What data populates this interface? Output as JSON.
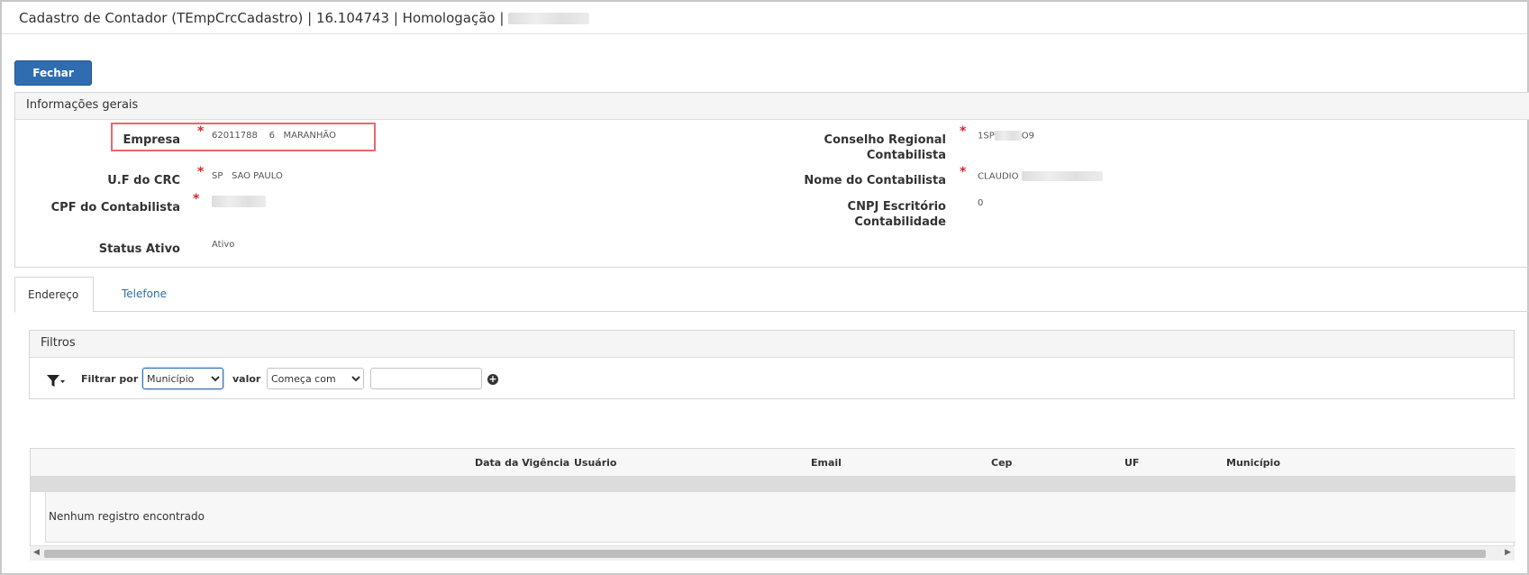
{
  "window": {
    "title": "Cadastro de Contador (TEmpCrcCadastro) | 16.104743 | Homologação |"
  },
  "toolbar": {
    "close_label": "Fechar"
  },
  "general_info": {
    "heading": "Informações gerais",
    "empresa": {
      "label": "Empresa",
      "code": "62011788",
      "num": "6",
      "name": "MARANHÃO"
    },
    "uf_crc": {
      "label": "U.F do CRC",
      "uf": "SP",
      "name": "SAO PAULO"
    },
    "cpf": {
      "label": "CPF do Contabilista"
    },
    "status": {
      "label": "Status Ativo",
      "value": "Ativo"
    },
    "conselho": {
      "label_line1": "Conselho Regional",
      "label_line2": "Contabilista",
      "prefix": "1SP",
      "suffix": "O9"
    },
    "nome": {
      "label": "Nome do Contabilista",
      "value": "CLAUDIO"
    },
    "cnpj": {
      "label_line1": "CNPJ Escritório",
      "label_line2": "Contabilidade",
      "value": "0"
    },
    "required_mark": "*"
  },
  "tabs": [
    {
      "label": "Endereço",
      "active": true
    },
    {
      "label": "Telefone",
      "active": false
    }
  ],
  "filters": {
    "heading": "Filtros",
    "filter_by_label": "Filtrar por",
    "field_selected": "Município",
    "value_label": "valor",
    "operator_selected": "Começa com",
    "value_input": ""
  },
  "grid": {
    "columns": [
      "Data da Vigência",
      "Usuário",
      "Email",
      "Cep",
      "UF",
      "Município"
    ],
    "empty_message": "Nenhum registro encontrado"
  },
  "icons": {
    "filter": "filter-icon",
    "add": "plus-circle-icon",
    "scroll_left": "chevron-left-icon",
    "scroll_right": "chevron-right-icon"
  },
  "colors": {
    "primary": "#2f6db0",
    "required": "#d9262c",
    "highlight_border": "#e8676d"
  }
}
